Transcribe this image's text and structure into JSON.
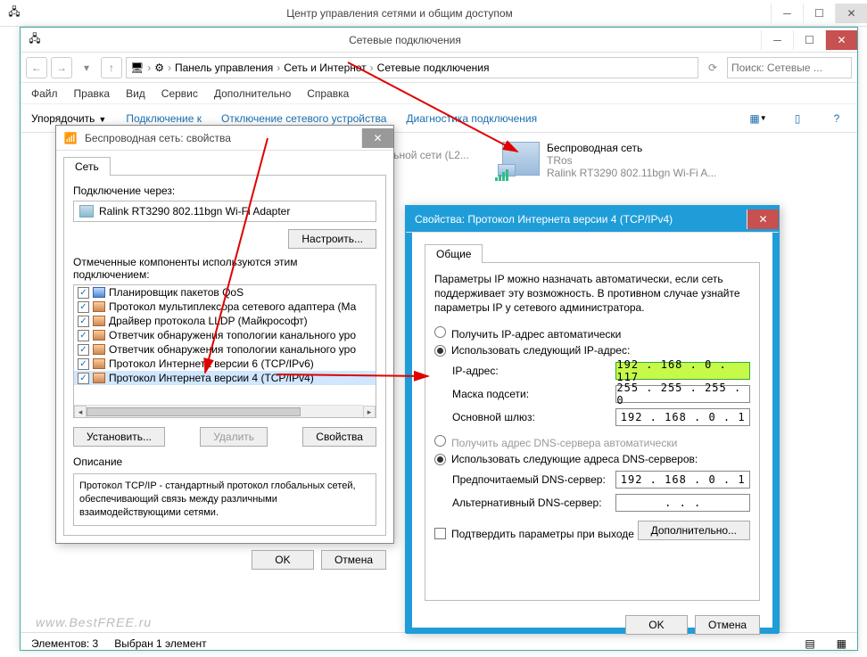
{
  "back_window_title": "Центр управления сетями и общим доступом",
  "win": {
    "title": "Сетевые подключения",
    "breadcrumb": {
      "root": "Панель управления",
      "lvl1": "Сеть и Интернет",
      "lvl2": "Сетевые подключения"
    },
    "search_placeholder": "Поиск: Сетевые ...",
    "menu": {
      "file": "Файл",
      "edit": "Правка",
      "view": "Вид",
      "service": "Сервис",
      "extra": "Дополнительно",
      "help": "Справка"
    },
    "cmd": {
      "organize": "Упорядочить",
      "connect": "Подключение к",
      "disable": "Отключение сетевого устройства",
      "diag": "Диагностика подключения"
    },
    "netitems": {
      "partial": "глобальной сети (L2...",
      "wifi": {
        "name": "Беспроводная сеть",
        "ssid": "TRos",
        "adapter": "Ralink RT3290 802.11bgn Wi-Fi A..."
      }
    },
    "status": {
      "count": "Элементов: 3",
      "sel": "Выбран 1 элемент"
    }
  },
  "props": {
    "title": "Беспроводная сеть: свойства",
    "tab": "Сеть",
    "via_label": "Подключение через:",
    "adapter": "Ralink RT3290 802.11bgn Wi-Fi Adapter",
    "configure": "Настроить...",
    "components_label": "Отмеченные компоненты используются этим подключением:",
    "items": [
      "Планировщик пакетов QoS",
      "Протокол мультиплексора сетевого адаптера (Ма",
      "Драйвер протокола LLDP (Майкрософт)",
      "Ответчик обнаружения топологии канального уро",
      "Ответчик обнаружения топологии канального уро",
      "Протокол Интернета версии 6 (TCP/IPv6)",
      "Протокол Интернета версии 4 (TCP/IPv4)"
    ],
    "install": "Установить...",
    "remove": "Удалить",
    "properties": "Свойства",
    "desc_label": "Описание",
    "desc": "Протокол TCP/IP - стандартный протокол глобальных сетей, обеспечивающий связь между различными взаимодействующими сетями.",
    "ok": "OK",
    "cancel": "Отмена"
  },
  "ipv4": {
    "title": "Свойства: Протокол Интернета версии 4 (TCP/IPv4)",
    "tab": "Общие",
    "intro": "Параметры IP можно назначать автоматически, если сеть поддерживает эту возможность. В противном случае узнайте параметры IP у сетевого администратора.",
    "radio_auto": "Получить IP-адрес автоматически",
    "radio_manual": "Использовать следующий IP-адрес:",
    "ip_label": "IP-адрес:",
    "ip": "192 . 168 .  0  . 117",
    "mask_label": "Маска подсети:",
    "mask": "255 . 255 . 255 .  0",
    "gw_label": "Основной шлюз:",
    "gw": "192 . 168 .  0  .  1",
    "dns_auto": "Получить адрес DNS-сервера автоматически",
    "dns_manual": "Использовать следующие адреса DNS-серверов:",
    "dns1_label": "Предпочитаемый DNS-сервер:",
    "dns1": "192 . 168 .  0  .  1",
    "dns2_label": "Альтернативный DNS-сервер:",
    "dns2": " .       .       . ",
    "validate": "Подтвердить параметры при выходе",
    "advanced": "Дополнительно...",
    "ok": "OK",
    "cancel": "Отмена"
  },
  "watermark": "www.BestFREE.ru"
}
